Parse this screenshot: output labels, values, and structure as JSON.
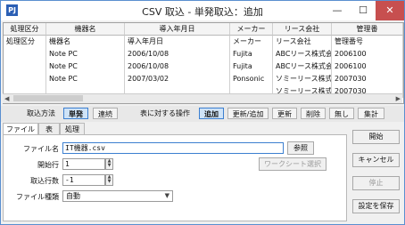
{
  "window": {
    "title": "CSV 取込 - 単発取込：追加",
    "icon": "PJ"
  },
  "grid": {
    "headers": [
      "処理区分",
      "機器名",
      "導入年月日",
      "メーカー",
      "リース会社",
      "管理番"
    ],
    "rows": [
      [
        "処理区分",
        "機器名",
        "導入年月日",
        "メーカー",
        "リース会社",
        "管理番号"
      ],
      [
        "",
        "Note PC",
        "2006/10/08",
        "Fujita",
        "ABCリース株式会社",
        "2006100"
      ],
      [
        "",
        "Note PC",
        "2006/10/08",
        "Fujita",
        "ABCリース株式会社",
        "2006100"
      ],
      [
        "",
        "Note PC",
        "2007/03/02",
        "Ponsonic",
        "ソミーリース株式会社",
        "2007030"
      ],
      [
        "",
        "",
        "",
        "",
        "ソミーリース株式会社",
        "2007030"
      ]
    ]
  },
  "toolbar": {
    "method_label": "取込方法",
    "method_buttons": [
      "単発",
      "連続"
    ],
    "operation_label": "表に対する操作",
    "operation_buttons": [
      "追加",
      "更新/追加",
      "更新",
      "削除",
      "無し",
      "集計"
    ]
  },
  "tabs": [
    "ファイル",
    "表",
    "処理"
  ],
  "form": {
    "file_label": "ファイル名",
    "file_value": "IT機器.csv",
    "browse_label": "参照",
    "start_row_label": "開始行",
    "start_row_value": "1",
    "sheet_select_label": "ワークシート選択",
    "row_count_label": "取込行数",
    "row_count_value": "-1",
    "file_type_label": "ファイル種類",
    "file_type_value": "自動"
  },
  "actions": {
    "start": "開始",
    "cancel": "キャンセル",
    "stop": "停止",
    "save": "設定を保存"
  }
}
